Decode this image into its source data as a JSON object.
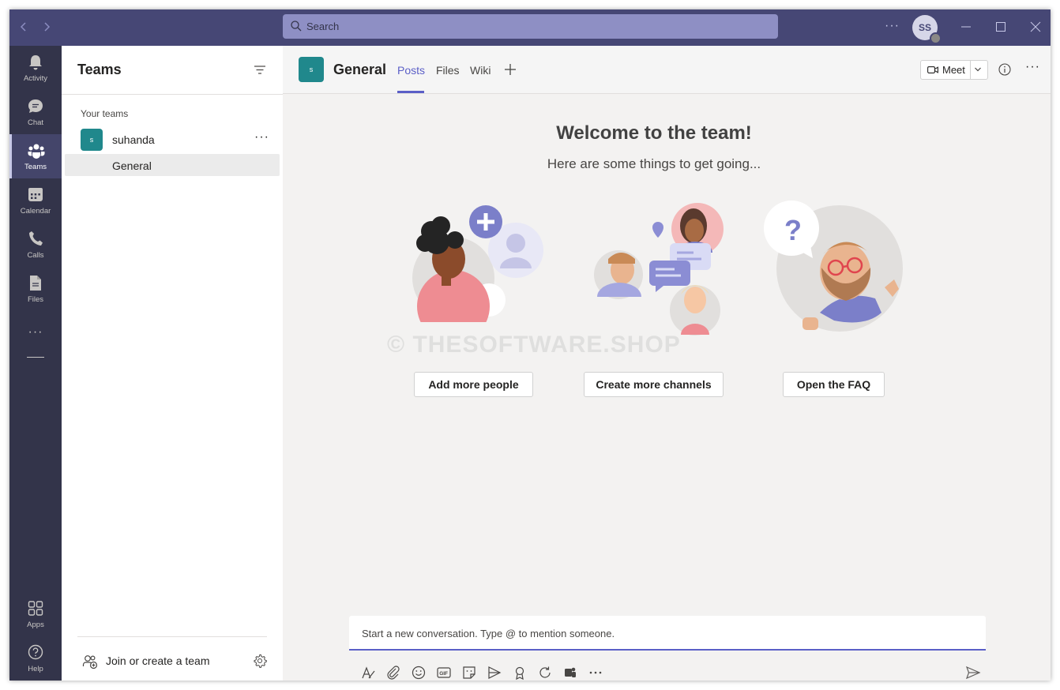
{
  "titlebar": {
    "back_icon": "chevron-left-icon",
    "forward_icon": "chevron-right-icon",
    "search_placeholder": "Search",
    "more": "···",
    "avatar_initials": "SS",
    "window_controls": [
      "minimize-icon",
      "maximize-icon",
      "close-icon"
    ],
    "bg_color": "#464775"
  },
  "rail": {
    "items": [
      {
        "label": "Activity",
        "icon": "bell-icon"
      },
      {
        "label": "Chat",
        "icon": "chat-icon"
      },
      {
        "label": "Teams",
        "icon": "teams-icon",
        "active": true
      },
      {
        "label": "Calendar",
        "icon": "calendar-icon"
      },
      {
        "label": "Calls",
        "icon": "phone-icon"
      },
      {
        "label": "Files",
        "icon": "file-icon"
      }
    ],
    "more": "···",
    "apps_label": "Apps",
    "help_label": "Help",
    "bg_color": "#33344a"
  },
  "teams_pane": {
    "title": "Teams",
    "section_label": "Your teams",
    "team": {
      "initial": "s",
      "name": "suhanda",
      "more": "···"
    },
    "channel": {
      "name": "General"
    },
    "join_label": "Join or create a team"
  },
  "main": {
    "channel_initial": "s",
    "channel_title": "General",
    "tabs": [
      "Posts",
      "Files",
      "Wiki"
    ],
    "active_tab": "Posts",
    "meet_label": "Meet",
    "more": "···",
    "welcome_title": "Welcome to the team!",
    "welcome_subtitle": "Here are some things to get going...",
    "actions": [
      "Add more people",
      "Create more channels",
      "Open the FAQ"
    ],
    "watermark": "© THESOFTWARE.SHOP",
    "compose_placeholder": "Start a new conversation. Type @ to mention someone.",
    "compose_toolbar": [
      "format-icon",
      "attach-icon",
      "emoji-icon",
      "gif-icon",
      "sticker-icon",
      "meet-now-icon",
      "praise-icon",
      "loop-icon",
      "more-apps-icon",
      "more-icon"
    ],
    "accent_color": "#5b5fc7",
    "team_color": "#20888c"
  }
}
